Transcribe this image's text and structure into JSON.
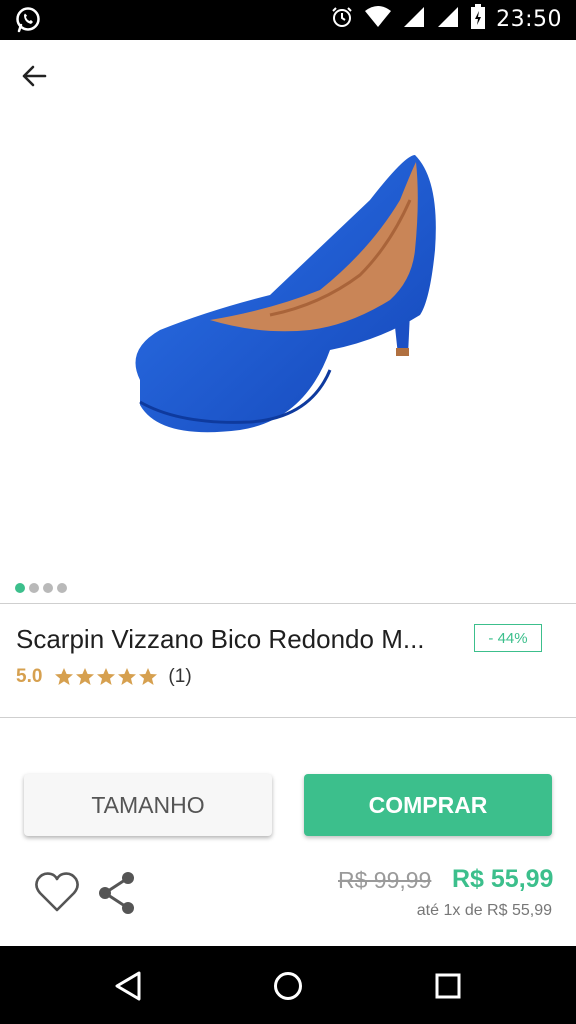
{
  "status_bar": {
    "time": "23:50",
    "icons": [
      "whatsapp-icon",
      "alarm-icon",
      "wifi-icon",
      "signal-icon",
      "signal-icon",
      "battery-icon"
    ]
  },
  "nav": {
    "back_icon": "arrow-back-icon"
  },
  "gallery": {
    "image_alt": "blue-suede-pump-shoe",
    "image_count": 4,
    "active_index": 0
  },
  "product": {
    "title": "Scarpin Vizzano Bico Redondo M...",
    "discount_badge": "- 44%",
    "rating_value": "5.0",
    "stars_filled": 5,
    "review_count": "(1)"
  },
  "actions": {
    "size_label": "TAMANHO",
    "buy_label": "COMPRAR",
    "favorite_icon": "heart-icon",
    "share_icon": "share-icon"
  },
  "pricing": {
    "old_price": "R$ 99,99",
    "new_price": "R$ 55,99",
    "installments": "até 1x de R$ 55,99"
  },
  "colors": {
    "accent": "#3cbf8c",
    "rating": "#d6a04f",
    "shoe_blue": "#1f5fd6"
  }
}
